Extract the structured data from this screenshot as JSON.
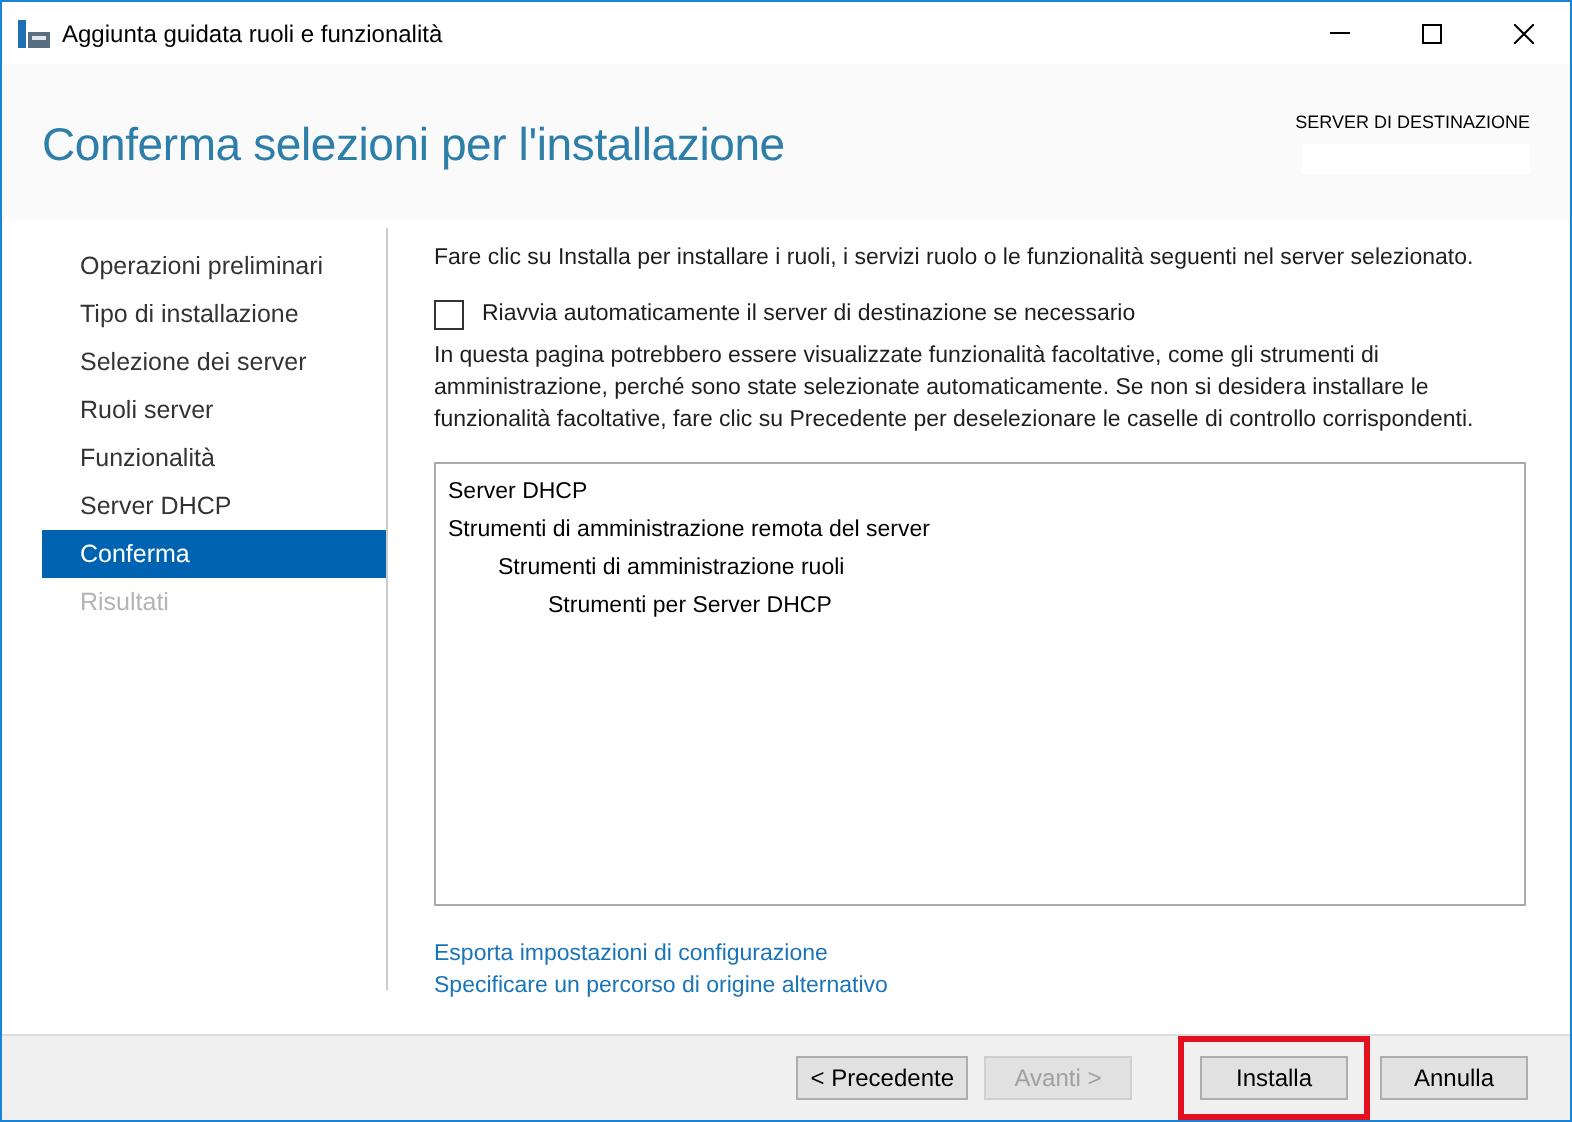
{
  "window": {
    "title": "Aggiunta guidata ruoli e funzionalità"
  },
  "header": {
    "title": "Conferma selezioni per l'installazione",
    "target_label": "SERVER DI DESTINAZIONE"
  },
  "steps": [
    {
      "label": "Operazioni preliminari",
      "selected": false,
      "disabled": false
    },
    {
      "label": "Tipo di installazione",
      "selected": false,
      "disabled": false
    },
    {
      "label": "Selezione dei server",
      "selected": false,
      "disabled": false
    },
    {
      "label": "Ruoli server",
      "selected": false,
      "disabled": false
    },
    {
      "label": "Funzionalità",
      "selected": false,
      "disabled": false
    },
    {
      "label": "Server DHCP",
      "selected": false,
      "disabled": false
    },
    {
      "label": "Conferma",
      "selected": true,
      "disabled": false
    },
    {
      "label": "Risultati",
      "selected": false,
      "disabled": true
    }
  ],
  "intro": "Fare clic su Installa per installare i ruoli, i servizi ruolo o le funzionalità seguenti nel server selezionato.",
  "restart_option": {
    "label": "Riavvia automaticamente il server di destinazione se necessario",
    "checked": false
  },
  "note": "In questa pagina potrebbero essere visualizzate funzionalità facoltative, come gli strumenti di amministrazione, perché sono state selezionate automaticamente. Se non si desidera installare le funzionalità facoltative, fare clic su Precedente per deselezionare le caselle di controllo corrispondenti.",
  "selections": [
    {
      "label": "Server DHCP"
    },
    {
      "label": "Strumenti di amministrazione remota del server",
      "children": [
        {
          "label": "Strumenti di amministrazione ruoli",
          "children": [
            {
              "label": "Strumenti per Server DHCP"
            }
          ]
        }
      ]
    }
  ],
  "links": [
    "Esporta impostazioni di configurazione",
    "Specificare un percorso di origine alternativo"
  ],
  "buttons": [
    {
      "label": "< Precedente",
      "disabled": false,
      "highlighted": false
    },
    {
      "label": "Avanti >",
      "disabled": true,
      "highlighted": false
    },
    {
      "label": "Installa",
      "disabled": false,
      "highlighted": true
    },
    {
      "label": "Annulla",
      "disabled": false,
      "highlighted": false
    }
  ]
}
